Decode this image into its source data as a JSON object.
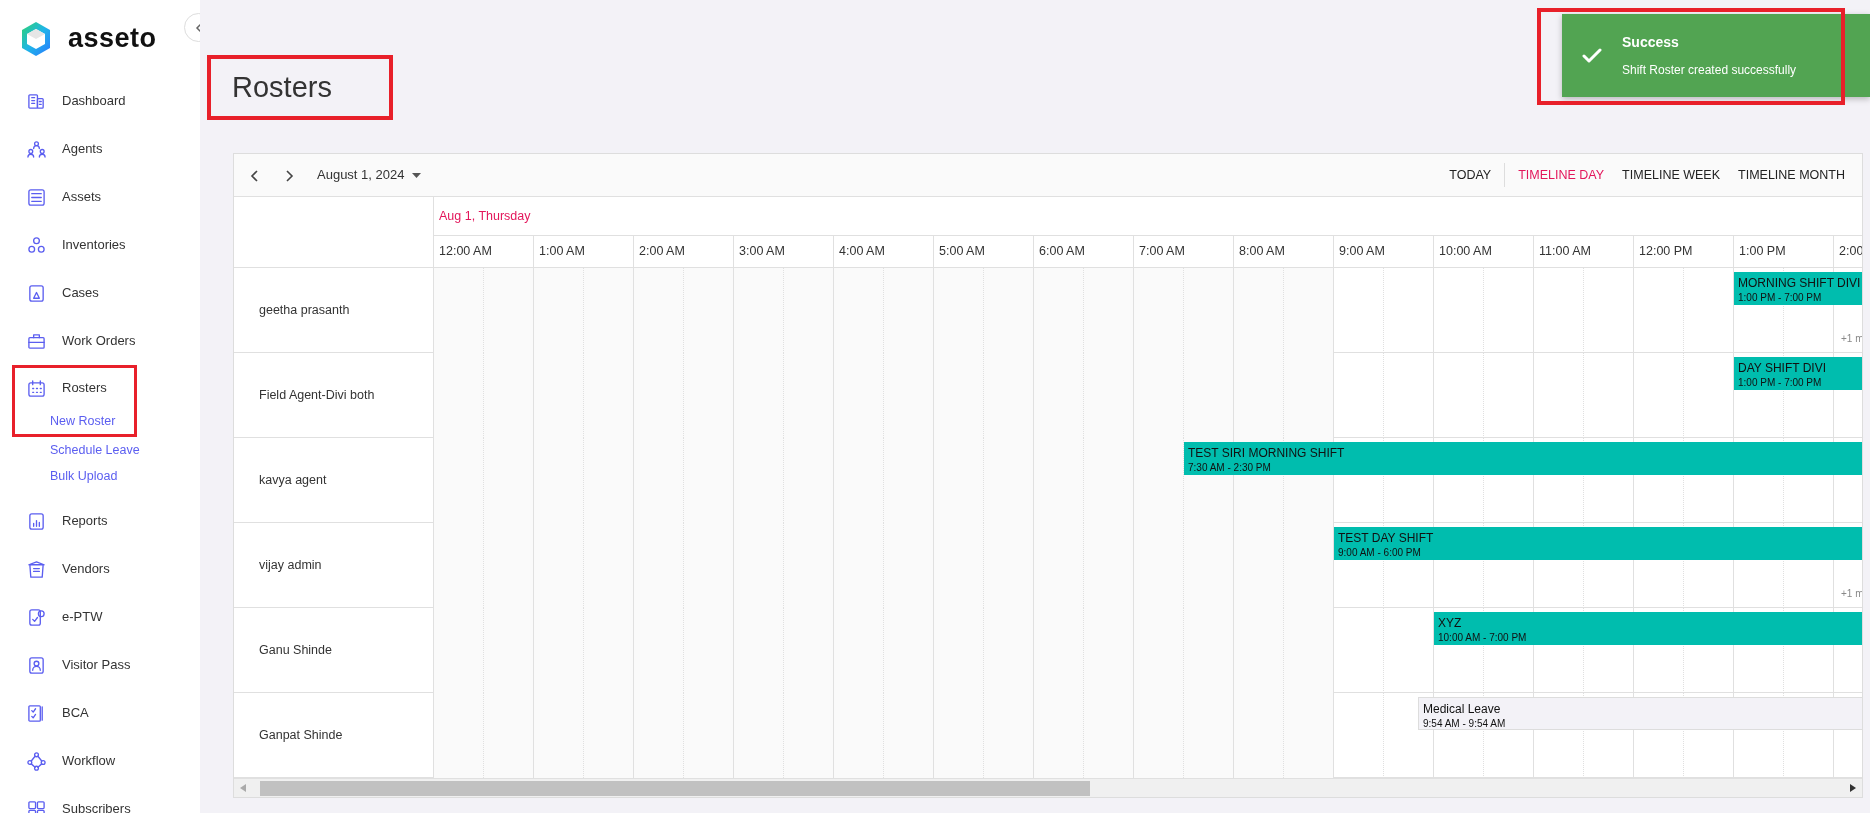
{
  "sidebar": {
    "logo": "asseto",
    "items": [
      {
        "label": "Dashboard",
        "highlighted": false
      },
      {
        "label": "Agents",
        "highlighted": false
      },
      {
        "label": "Assets",
        "highlighted": false
      },
      {
        "label": "Inventories",
        "highlighted": false
      },
      {
        "label": "Cases",
        "highlighted": false
      },
      {
        "label": "Work Orders",
        "highlighted": false
      },
      {
        "label": "Rosters",
        "highlighted": true,
        "children": [
          {
            "label": "New Roster"
          },
          {
            "label": "Schedule Leave"
          },
          {
            "label": "Bulk Upload"
          }
        ]
      },
      {
        "label": "Reports",
        "highlighted": false
      },
      {
        "label": "Vendors",
        "highlighted": false
      },
      {
        "label": "e-PTW",
        "highlighted": false
      },
      {
        "label": "Visitor Pass",
        "highlighted": false
      },
      {
        "label": "BCA",
        "highlighted": false
      },
      {
        "label": "Workflow",
        "highlighted": false
      },
      {
        "label": "Subscribers",
        "highlighted": false
      }
    ]
  },
  "page": {
    "title": "Rosters",
    "highlighted": true
  },
  "toast": {
    "title": "Success",
    "message": "Shift Roster created successfully",
    "highlighted": true
  },
  "scheduler": {
    "date": "August 1, 2024",
    "views": [
      {
        "label": "TODAY",
        "selected": false
      },
      {
        "label": "TIMELINE DAY",
        "selected": true
      },
      {
        "label": "TIMELINE WEEK",
        "selected": false
      },
      {
        "label": "TIMELINE MONTH",
        "selected": false
      }
    ],
    "day_header": "Aug 1, Thursday",
    "hours": [
      {
        "label": "12:00 AM",
        "working": false
      },
      {
        "label": "1:00 AM",
        "working": false
      },
      {
        "label": "2:00 AM",
        "working": false
      },
      {
        "label": "3:00 AM",
        "working": false
      },
      {
        "label": "4:00 AM",
        "working": false
      },
      {
        "label": "5:00 AM",
        "working": false
      },
      {
        "label": "6:00 AM",
        "working": false
      },
      {
        "label": "7:00 AM",
        "working": false
      },
      {
        "label": "8:00 AM",
        "working": false
      },
      {
        "label": "9:00 AM",
        "working": true
      },
      {
        "label": "10:00 AM",
        "working": true
      },
      {
        "label": "11:00 AM",
        "working": true
      },
      {
        "label": "12:00 PM",
        "working": true
      },
      {
        "label": "1:00 PM",
        "working": true
      },
      {
        "label": "2:00",
        "working": true
      }
    ],
    "rows": [
      {
        "name": "geetha prasanth",
        "more": "+1 m",
        "events": [
          {
            "kind": "shift",
            "title": "MORNING SHIFT DIVI",
            "time": "1:00 PM - 7:00 PM"
          }
        ]
      },
      {
        "name": "Field Agent-Divi both",
        "events": [
          {
            "kind": "shift",
            "title": "DAY SHIFT DIVI",
            "time": "1:00 PM - 7:00 PM"
          }
        ]
      },
      {
        "name": "kavya agent",
        "events": [
          {
            "kind": "shift",
            "title": "TEST SIRI MORNING SHIFT",
            "time": "7:30 AM - 2:30 PM"
          }
        ]
      },
      {
        "name": "vijay admin",
        "more": "+1 m",
        "events": [
          {
            "kind": "shift",
            "title": "TEST DAY SHIFT",
            "time": "9:00 AM - 6:00 PM"
          }
        ]
      },
      {
        "name": "Ganu Shinde",
        "events": [
          {
            "kind": "shift",
            "title": "XYZ",
            "time": "10:00 AM - 7:00 PM"
          }
        ]
      },
      {
        "name": "Ganpat Shinde",
        "events": [
          {
            "kind": "leave",
            "title": "Medical Leave",
            "time": "9:54 AM - 9:54 AM"
          }
        ]
      }
    ]
  }
}
